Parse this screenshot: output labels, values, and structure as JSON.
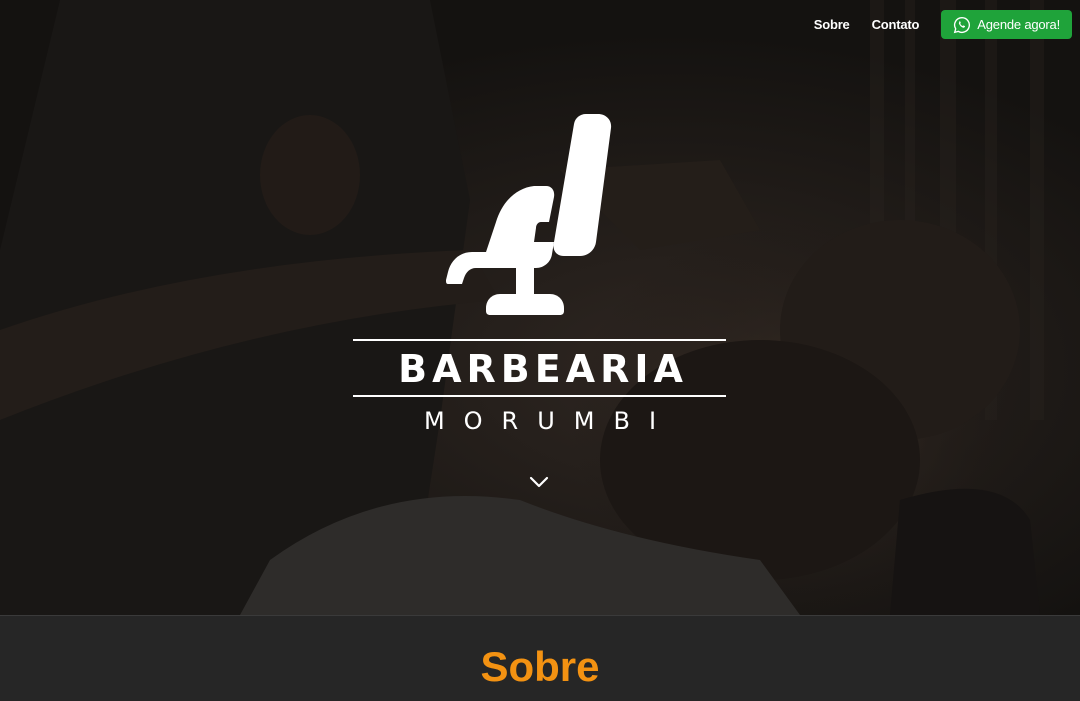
{
  "nav": {
    "links": [
      {
        "label": "Sobre"
      },
      {
        "label": "Contato"
      }
    ],
    "cta": {
      "label": "Agende agora!",
      "icon": "whatsapp-icon",
      "color": "#1fa33a"
    }
  },
  "hero": {
    "logo_icon": "barber-chair-icon",
    "brand": "BARBEARIA",
    "subtitle": "MORUMBI",
    "scroll_icon": "chevron-down-icon"
  },
  "about": {
    "title": "Sobre",
    "accent_color": "#f39212"
  }
}
